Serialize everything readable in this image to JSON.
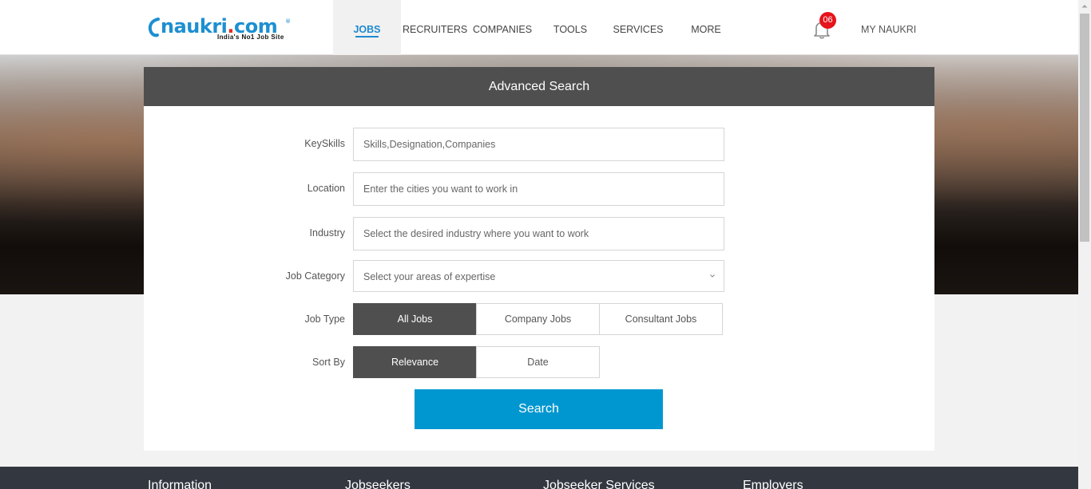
{
  "header": {
    "logo": {
      "text_main": "naukri",
      "text_dot": ".",
      "text_tld": "com",
      "registered": "®",
      "tagline": "India's No1 Job Site"
    },
    "nav": [
      {
        "label": "JOBS",
        "active": true
      },
      {
        "label": "RECRUITERS",
        "active": false
      },
      {
        "label": "COMPANIES",
        "active": false
      },
      {
        "label": "TOOLS",
        "active": false
      },
      {
        "label": "SERVICES",
        "active": false
      },
      {
        "label": "MORE",
        "active": false
      }
    ],
    "notifications": {
      "icon": "bell-icon",
      "count": "06"
    },
    "account_label": "MY NAUKRI"
  },
  "search_panel": {
    "title": "Advanced Search",
    "keyskills": {
      "label": "KeySkills",
      "placeholder": "Skills,Designation,Companies"
    },
    "location": {
      "label": "Location",
      "placeholder": "Enter the cities you want to work in"
    },
    "industry": {
      "label": "Industry",
      "placeholder": "Select the desired industry where you want to work"
    },
    "job_category": {
      "label": "Job Category",
      "placeholder": "Select your areas of expertise",
      "icon": "chevron-down-icon"
    },
    "job_type": {
      "label": "Job Type",
      "options": [
        "All Jobs",
        "Company Jobs",
        "Consultant Jobs"
      ],
      "selected": "All Jobs"
    },
    "sort_by": {
      "label": "Sort By",
      "options": [
        "Relevance",
        "Date"
      ],
      "selected": "Relevance"
    },
    "search_button": "Search"
  },
  "footer": {
    "columns": [
      "Information",
      "Jobseekers",
      "Jobseeker Services",
      "Employers"
    ]
  },
  "colors": {
    "brand_blue": "#1d8fd1",
    "header_dark": "#4f4f4f",
    "search_button": "#0097d0",
    "badge_red": "#e6131b",
    "footer_bg": "#333740"
  }
}
